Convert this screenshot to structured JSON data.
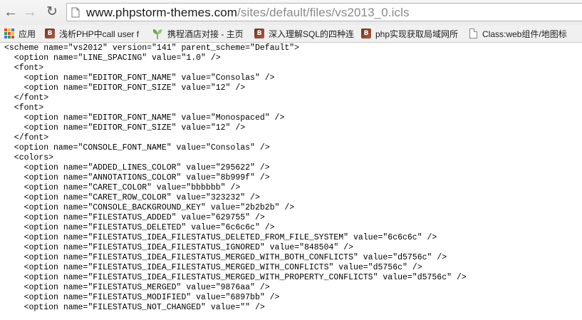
{
  "browser": {
    "url_host": "www.phpstorm-themes.com",
    "url_path": "/sites/default/files/vs2013_0.icls"
  },
  "bookmarks": [
    {
      "label": "应用",
      "icon": "apps-grid-icon"
    },
    {
      "label": "浅析PHP中call user f",
      "icon": "bookmark-favicon-icon"
    },
    {
      "label": "携程酒店对接 - 主页",
      "icon": "leaf-icon"
    },
    {
      "label": "深入理解SQL的四种连",
      "icon": "bookmark-favicon-icon"
    },
    {
      "label": "php实现获取局域网所",
      "icon": "bookmark-favicon-icon"
    },
    {
      "label": "Class:web组件/地图标",
      "icon": "document-icon"
    }
  ],
  "icon_colors": {
    "apps": [
      "#e8453c",
      "#f9bb2d",
      "#3b7de0",
      "#3a9b4c",
      "#e8453c",
      "#f9bb2d",
      "#3b7de0",
      "#3a9b4c",
      "#e8453c"
    ],
    "leaf": "#6aa84f"
  },
  "content_lines": [
    "<scheme name=\"vs2012\" version=\"141\" parent_scheme=\"Default\">",
    "  <option name=\"LINE_SPACING\" value=\"1.0\" />",
    "  <font>",
    "    <option name=\"EDITOR_FONT_NAME\" value=\"Consolas\" />",
    "    <option name=\"EDITOR_FONT_SIZE\" value=\"12\" />",
    "  </font>",
    "  <font>",
    "    <option name=\"EDITOR_FONT_NAME\" value=\"Monospaced\" />",
    "    <option name=\"EDITOR_FONT_SIZE\" value=\"12\" />",
    "  </font>",
    "  <option name=\"CONSOLE_FONT_NAME\" value=\"Consolas\" />",
    "  <colors>",
    "    <option name=\"ADDED_LINES_COLOR\" value=\"295622\" />",
    "    <option name=\"ANNOTATIONS_COLOR\" value=\"8b999f\" />",
    "    <option name=\"CARET_COLOR\" value=\"bbbbbb\" />",
    "    <option name=\"CARET_ROW_COLOR\" value=\"323232\" />",
    "    <option name=\"CONSOLE_BACKGROUND_KEY\" value=\"2b2b2b\" />",
    "    <option name=\"FILESTATUS_ADDED\" value=\"629755\" />",
    "    <option name=\"FILESTATUS_DELETED\" value=\"6c6c6c\" />",
    "    <option name=\"FILESTATUS_IDEA_FILESTATUS_DELETED_FROM_FILE_SYSTEM\" value=\"6c6c6c\" />",
    "    <option name=\"FILESTATUS_IDEA_FILESTATUS_IGNORED\" value=\"848504\" />",
    "    <option name=\"FILESTATUS_IDEA_FILESTATUS_MERGED_WITH_BOTH_CONFLICTS\" value=\"d5756c\" />",
    "    <option name=\"FILESTATUS_IDEA_FILESTATUS_MERGED_WITH_CONFLICTS\" value=\"d5756c\" />",
    "    <option name=\"FILESTATUS_IDEA_FILESTATUS_MERGED_WITH_PROPERTY_CONFLICTS\" value=\"d5756c\" />",
    "    <option name=\"FILESTATUS_MERGED\" value=\"9876aa\" />",
    "    <option name=\"FILESTATUS_MODIFIED\" value=\"6897bb\" />",
    "    <option name=\"FILESTATUS_NOT_CHANGED\" value=\"\" />"
  ]
}
